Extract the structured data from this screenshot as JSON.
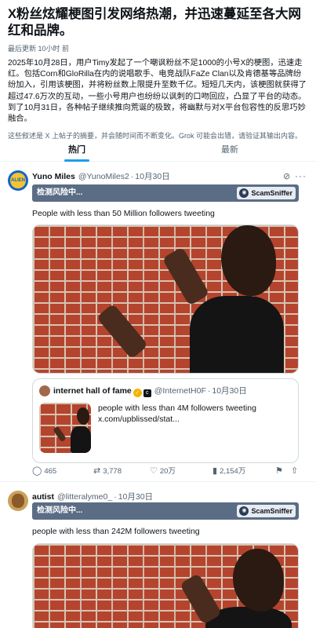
{
  "summary": {
    "headline": "X粉丝炫耀梗图引发网络热潮，并迅速蔓延至各大网红和品牌。",
    "updated": "最后更新 10小时 前",
    "body": "2025年10月28日，用户Timy发起了一个嘲讽粉丝不足1000的小号X的梗图，迅速走红。包括Corn和GloRilla在内的说唱歌手、电竞战队FaZe Clan以及肯德基等品牌纷纷加入，引用该梗图，并将粉丝数上限提升至数千亿。短短几天内，该梗图就获得了超过47.6万次的互动，一些小号用户也纷纷以讽刺的口吻回应，凸显了平台的动态。到了10月31日，各种帖子继续推向荒诞的极致，将幽默与对X平台包容性的反思巧妙融合。",
    "disclaimer": "这些叙述是 X 上帖子的摘要，并会随时间而不断变化。Grok 可能会出错，请验证其输出内容。"
  },
  "tabs": [
    {
      "label": "热门",
      "active": true
    },
    {
      "label": "最新",
      "active": false
    }
  ],
  "posts": [
    {
      "author": "Yuno Miles",
      "handle": "@YunoMiles2",
      "date": "10月30日",
      "avatar_text": "ALIEN",
      "risk_text": "检测风险中...",
      "sniffer_label": "ScamSniffer",
      "text": "People with less than 50 Million followers tweeting",
      "quote": {
        "author": "internet hall of fame",
        "handle": "@InternetH0F",
        "date": "10月30日",
        "badge": "c",
        "text": "people with less than 4M followers tweeting x.com/upblissed/stat..."
      },
      "stats": {
        "replies": "465",
        "retweets": "3,778",
        "likes": "20万",
        "views": "2,154万"
      }
    },
    {
      "author": "autist",
      "handle": "@litteralyme0_",
      "date": "10月30日",
      "risk_text": "检测风险中...",
      "sniffer_label": "ScamSniffer",
      "text": "people with less than 242M followers tweeting"
    }
  ],
  "colors": {
    "accent": "#1d9bf0",
    "risk_bar": "#5b6c85",
    "brick": "#b5442e"
  },
  "icons": {
    "grok": "grok-icon",
    "more": "more-icon",
    "reply": "reply-icon",
    "retweet": "retweet-icon",
    "like": "heart-icon",
    "views": "views-icon",
    "bookmark": "bookmark-icon",
    "share": "share-icon"
  }
}
